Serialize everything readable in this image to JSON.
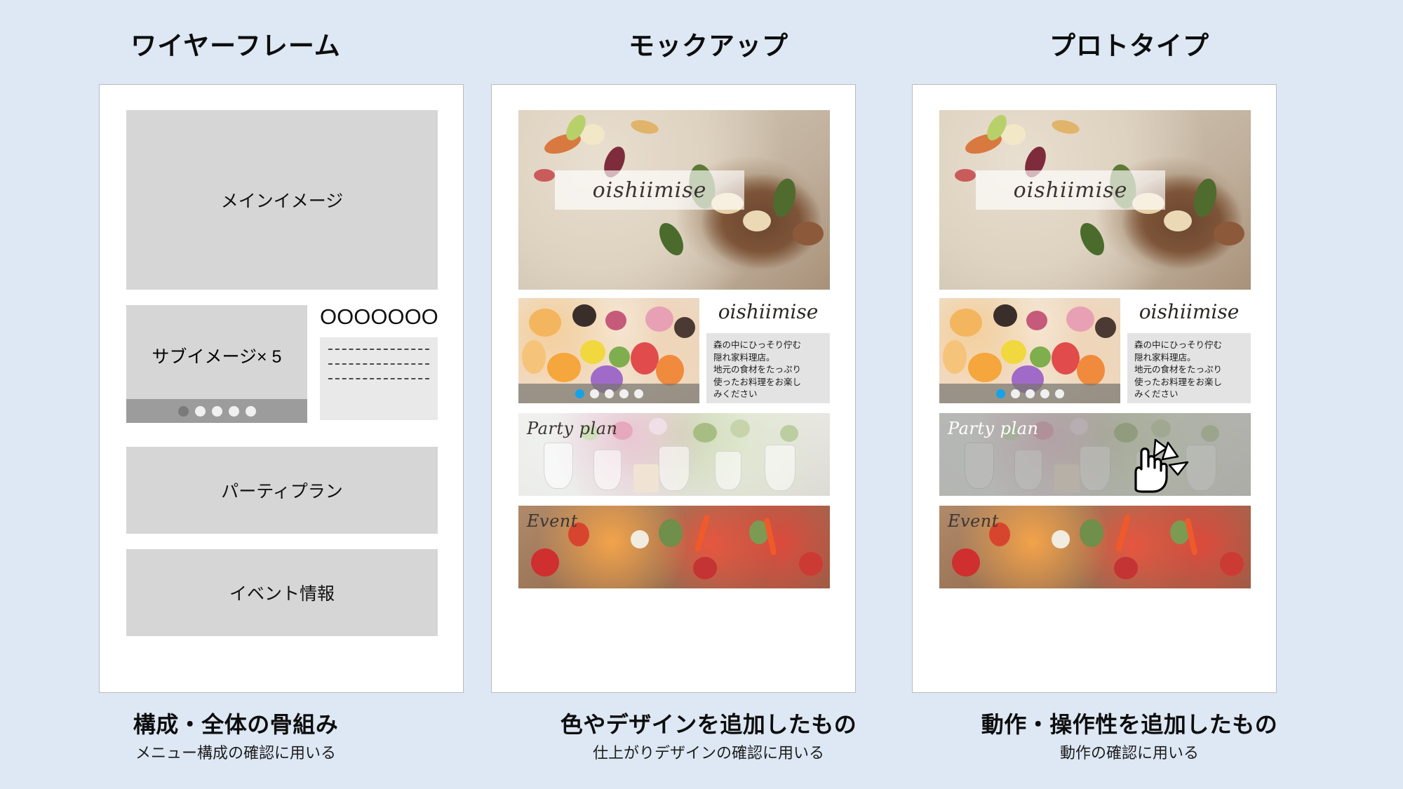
{
  "background_color": "#dde8f4",
  "columns": [
    {
      "id": "wireframe",
      "title": "ワイヤーフレーム",
      "caption_main": "構成・全体の骨組み",
      "caption_sub": "メニュー構成の確認に用いる",
      "blocks": {
        "hero_label": "メインイメージ",
        "sub_label": "サブイメージ× 5",
        "nav_placeholder": "OOOOOOO",
        "text_lines": [
          "----------------------",
          "----------------------",
          "----------------------"
        ],
        "party_label": "パーティプラン",
        "event_label": "イベント情報"
      },
      "carousel": {
        "total_dots": 5,
        "active_index": 0,
        "active_color": "#7a7a7a"
      }
    },
    {
      "id": "mockup",
      "title": "モックアップ",
      "caption_main": "色やデザインを追加したもの",
      "caption_sub": "仕上がりデザインの確認に用いる",
      "blocks": {
        "hero_logo": "oishiimise",
        "brand_logo": "oishiimise",
        "description": "森の中にひっそり佇む\n隠れ家料理店。\n地元の食材をたっぷり\n使ったお料理をお楽し\nみください",
        "description_lines": [
          "森の中にひっそり佇む",
          "隠れ家料理店。",
          "地元の食材をたっぷり",
          "使ったお料理をお楽し",
          "みください"
        ],
        "party_label": "Party plan",
        "event_label": "Event"
      },
      "carousel": {
        "total_dots": 5,
        "active_index": 0,
        "active_color": "#14a3e8"
      },
      "party_hover": false
    },
    {
      "id": "prototype",
      "title": "プロトタイプ",
      "caption_main": "動作・操作性を追加したもの",
      "caption_sub": "動作の確認に用いる",
      "blocks": {
        "hero_logo": "oishiimise",
        "brand_logo": "oishiimise",
        "description_lines": [
          "森の中にひっそり佇む",
          "隠れ家料理店。",
          "地元の食材をたっぷり",
          "使ったお料理をお楽し",
          "みください"
        ],
        "party_label": "Party plan",
        "event_label": "Event"
      },
      "carousel": {
        "total_dots": 5,
        "active_index": 0,
        "active_color": "#14a3e8"
      },
      "party_hover": true,
      "cursor": {
        "icon": "pointing-hand-cursor",
        "click_burst": true
      }
    }
  ]
}
